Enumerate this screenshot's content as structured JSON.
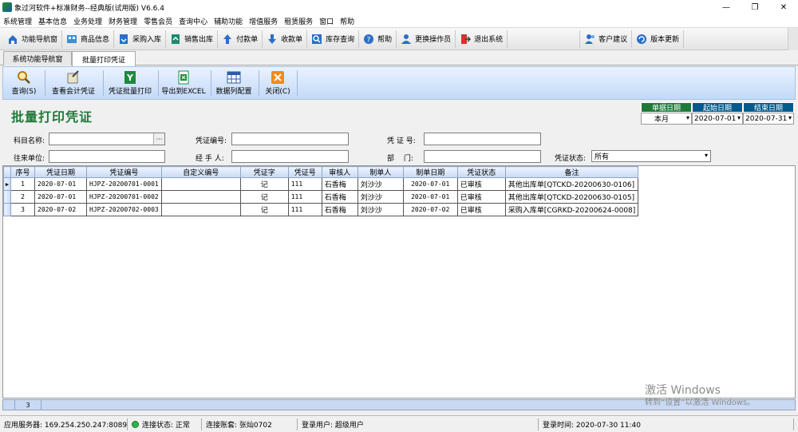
{
  "window": {
    "title": "象过河软件+标准财务--经典版(试用版) V6.6.4",
    "min": "—",
    "restore": "❐",
    "close": "✕"
  },
  "menu": [
    "系统管理",
    "基本信息",
    "业务处理",
    "财务管理",
    "零售会员",
    "查询中心",
    "辅助功能",
    "增值服务",
    "租赁服务",
    "窗口",
    "帮助"
  ],
  "toolbar1": [
    {
      "label": "功能导航窗",
      "icon": "home-icon"
    },
    {
      "label": "商品信息",
      "icon": "goods-icon"
    },
    {
      "label": "采购入库",
      "icon": "purchase-icon"
    },
    {
      "label": "销售出库",
      "icon": "sales-icon"
    },
    {
      "label": "付款单",
      "icon": "pay-icon"
    },
    {
      "label": "收款单",
      "icon": "receive-icon"
    },
    {
      "label": "库存查询",
      "icon": "stock-icon"
    },
    {
      "label": "帮助",
      "icon": "help-icon"
    },
    {
      "label": "更换操作员",
      "icon": "user-icon"
    },
    {
      "label": "退出系统",
      "icon": "exit-icon"
    },
    {
      "label": "客户建议",
      "icon": "suggest-icon"
    },
    {
      "label": "版本更新",
      "icon": "update-icon"
    }
  ],
  "tabs": [
    {
      "label": "系统功能导航窗"
    },
    {
      "label": "批量打印凭证"
    }
  ],
  "toolbar2": [
    {
      "label": "查询(S)",
      "icon": "search-icon"
    },
    {
      "label": "查看会计凭证",
      "icon": "voucher-icon"
    },
    {
      "label": "凭证批量打印",
      "icon": "print-icon"
    },
    {
      "label": "导出到EXCEL",
      "icon": "excel-icon"
    },
    {
      "label": "数据列配置",
      "icon": "grid-config-icon"
    },
    {
      "label": "关闭(C)",
      "icon": "close-icon"
    }
  ],
  "page_title": "批量打印凭证",
  "date_filter": {
    "h1": "单据日期",
    "h2": "起始日期",
    "h3": "结束日期",
    "v1": "本月",
    "v2": "2020-07-01",
    "v3": "2020-07-31"
  },
  "form": {
    "subject_label": "科目名称:",
    "subject_value": "",
    "subject_btn": "···",
    "vno_label": "凭证编号:",
    "vno_value": "",
    "vzh_label": "凭 证 号:",
    "vzh_value": "",
    "partner_label": "往来单位:",
    "partner_value": "",
    "handler_label": "经 手 人:",
    "handler_value": "",
    "dept_label": "部　 门:",
    "dept_value": "",
    "status_label": "凭证状态:",
    "status_value": "所有"
  },
  "table": {
    "headers": [
      "序号",
      "凭证日期",
      "凭证编号",
      "自定义编号",
      "凭证字",
      "凭证号",
      "审核人",
      "制单人",
      "制单日期",
      "凭证状态",
      "备注"
    ],
    "rows": [
      [
        "1",
        "2020-07-01",
        "HJPZ-20200701-0001",
        "",
        "记",
        "111",
        "石香梅",
        "刘沙沙",
        "2020-07-01",
        "已审核",
        "其他出库单[QTCKD-20200630-0106]"
      ],
      [
        "2",
        "2020-07-01",
        "HJPZ-20200701-0002",
        "",
        "记",
        "111",
        "石香梅",
        "刘沙沙",
        "2020-07-01",
        "已审核",
        "其他出库单[QTCKD-20200630-0105]"
      ],
      [
        "3",
        "2020-07-02",
        "HJPZ-20200702-0003",
        "",
        "记",
        "111",
        "石香梅",
        "刘沙沙",
        "2020-07-02",
        "已审核",
        "采购入库单[CGRKD-20200624-0008]"
      ]
    ],
    "count": "3"
  },
  "watermark": {
    "line1": "激活 Windows",
    "line2": "转到“设置”以激活 Windows。"
  },
  "status": {
    "server": "应用服务器: 169.254.250.247:8089",
    "conn": "连接状态: 正常",
    "account": "连接账套: 张灿0702",
    "user": "登录用户: 超级用户",
    "time": "登录时间: 2020-07-30 11:40"
  },
  "colors": {
    "title_green": "#1f7a3a",
    "header_blue": "#005a8c",
    "toolbar_blue": "#c3d9f7"
  }
}
